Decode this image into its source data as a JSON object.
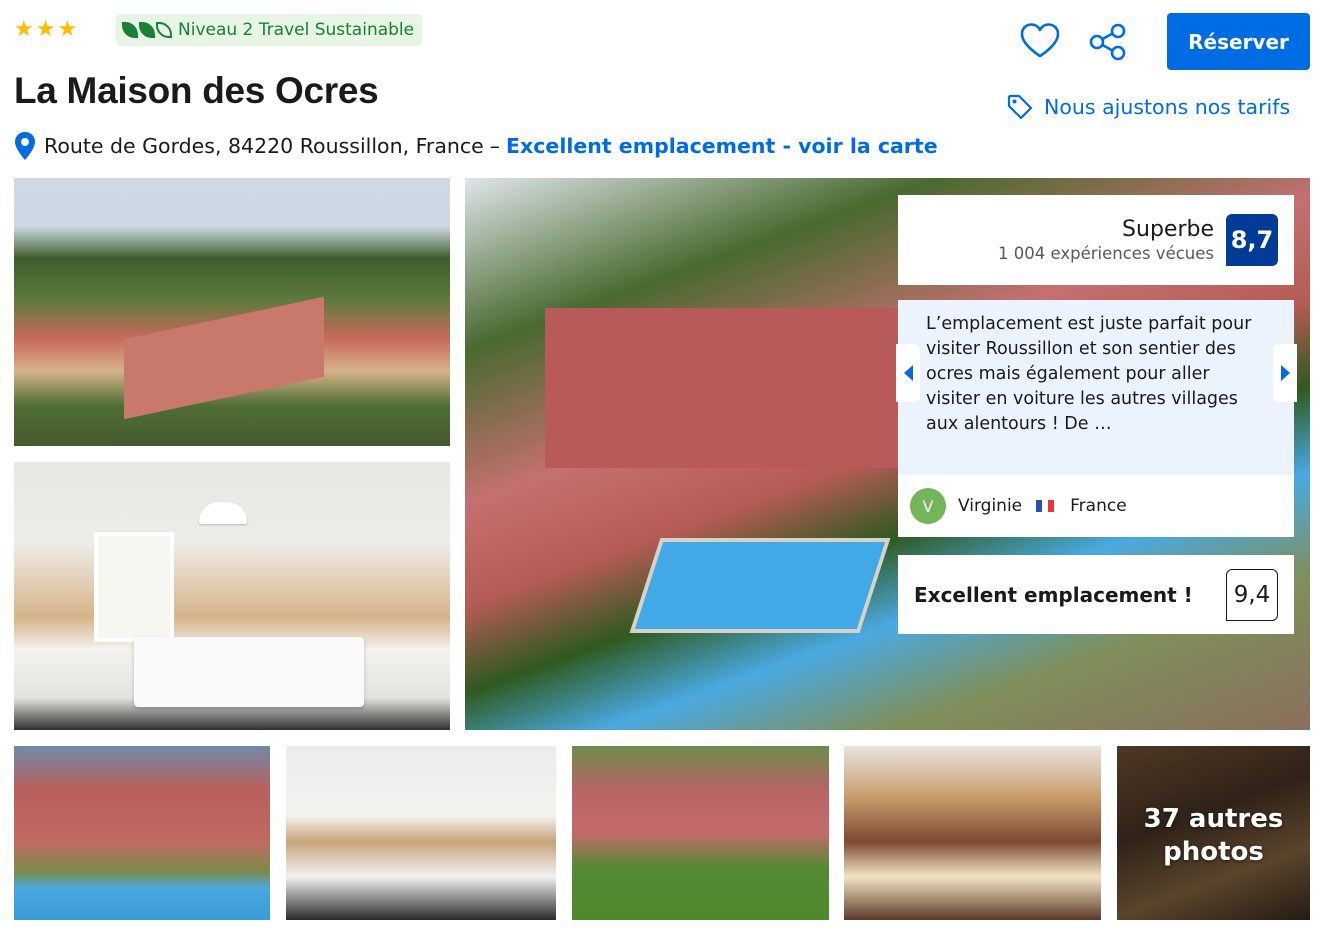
{
  "header": {
    "star_count": 3,
    "sustainability_label": "Niveau 2 Travel Sustainable",
    "sustainability_leaves": 3,
    "title": "La Maison des Ocres",
    "address": "Route de Gordes, 84220 Roussillon, France",
    "separator": "–",
    "map_link": "Excellent emplacement - voir la carte",
    "reserve_label": "Réserver",
    "price_match_label": "Nous ajustons nos tarifs"
  },
  "rating": {
    "label": "Superbe",
    "count": "1 004 expériences vécues",
    "score": "8,7"
  },
  "review": {
    "quote": "L’emplacement est juste parfait pour visiter Roussillon et son sentier des ocres mais également pour aller visiter en voiture les autres villages aux alentours ! De …",
    "author_initial": "V",
    "author_name": "Virginie",
    "author_country": "France"
  },
  "location": {
    "label": "Excellent emplacement !",
    "score": "9,4"
  },
  "gallery": {
    "more_photos_line1": "37 autres",
    "more_photos_line2": "photos"
  },
  "colors": {
    "accent": "#006ce4",
    "score_badge": "#003b95",
    "star": "#febb02",
    "sustain_green": "#1a7f37",
    "sustain_bg": "#e7f5e5",
    "review_bg": "#ebf3ff"
  },
  "icons": {
    "star": "star-icon",
    "leaf": "leaf-icon",
    "pin": "map-pin-icon",
    "heart": "heart-icon",
    "share": "share-icon",
    "tag": "price-tag-icon"
  }
}
